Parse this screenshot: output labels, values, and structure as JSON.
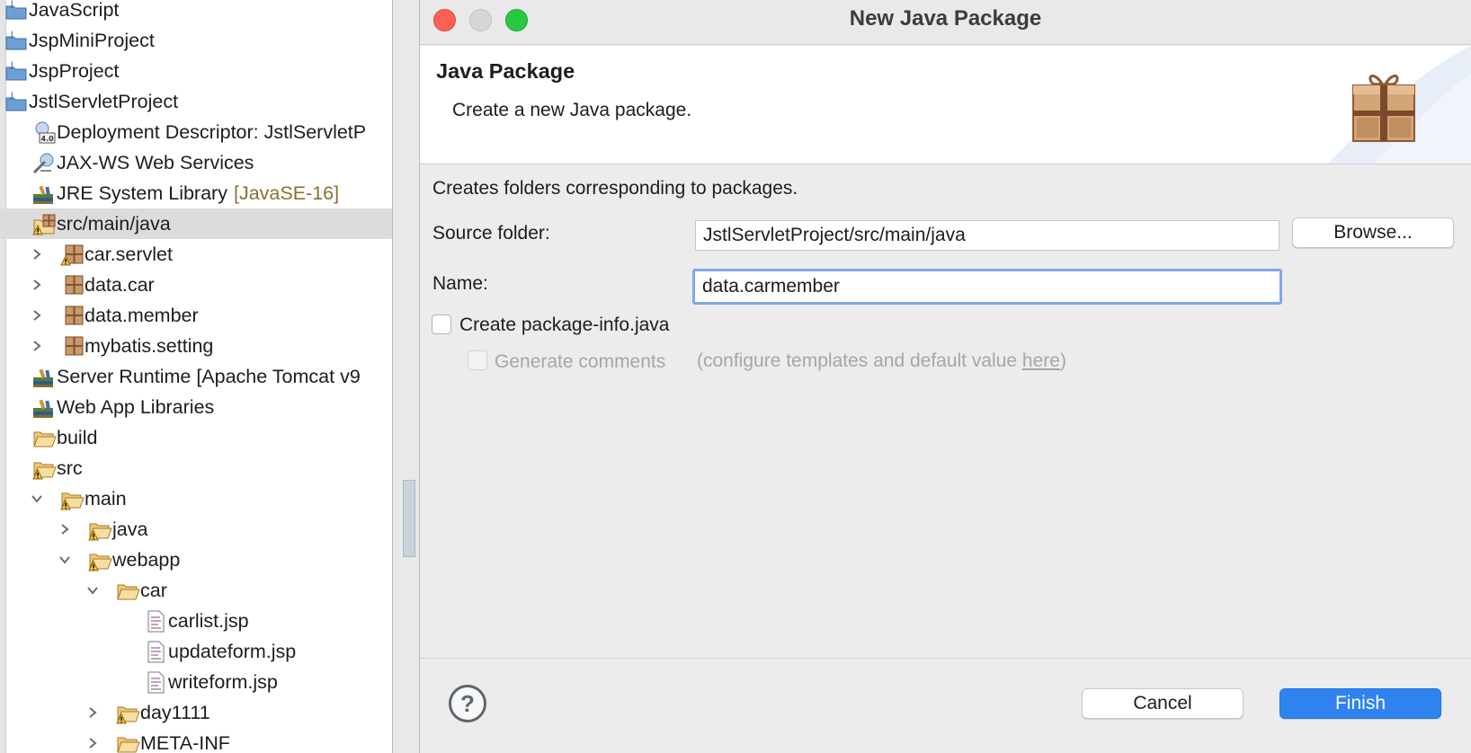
{
  "explorer": {
    "items": [
      {
        "label": "JavaScript",
        "icon": "js-project-icon",
        "indent": 0,
        "twisty": "none"
      },
      {
        "label": "JspMiniProject",
        "icon": "java-project-icon",
        "indent": 0,
        "twisty": "none"
      },
      {
        "label": "JspProject",
        "icon": "java-project-icon",
        "indent": 0,
        "twisty": "none"
      },
      {
        "label": "JstlServletProject",
        "icon": "java-project-icon",
        "indent": 0,
        "twisty": "none"
      },
      {
        "label": "Deployment Descriptor: JstlServletP",
        "icon": "deployment-descriptor-icon",
        "indent": 1,
        "twisty": "none"
      },
      {
        "label": "JAX-WS Web Services",
        "icon": "web-services-icon",
        "indent": 1,
        "twisty": "none"
      },
      {
        "label": "JRE System Library",
        "decoration": "[JavaSE-16]",
        "icon": "library-icon",
        "indent": 1,
        "twisty": "none"
      },
      {
        "label": "src/main/java",
        "icon": "source-folder-icon",
        "indent": 1,
        "twisty": "none",
        "selected": true
      },
      {
        "label": "car.servlet",
        "icon": "package-warning-icon",
        "indent": 2,
        "twisty": "collapsed"
      },
      {
        "label": "data.car",
        "icon": "package-icon",
        "indent": 2,
        "twisty": "collapsed"
      },
      {
        "label": "data.member",
        "icon": "package-icon",
        "indent": 2,
        "twisty": "collapsed"
      },
      {
        "label": "mybatis.setting",
        "icon": "package-icon",
        "indent": 2,
        "twisty": "collapsed"
      },
      {
        "label": "Server Runtime [Apache Tomcat v9",
        "icon": "library-icon",
        "indent": 1,
        "twisty": "none"
      },
      {
        "label": "Web App Libraries",
        "icon": "library-icon",
        "indent": 1,
        "twisty": "none"
      },
      {
        "label": "build",
        "icon": "folder-icon",
        "indent": 1,
        "twisty": "none"
      },
      {
        "label": "src",
        "icon": "folder-warning-icon",
        "indent": 1,
        "twisty": "none"
      },
      {
        "label": "main",
        "icon": "folder-warning-icon",
        "indent": 2,
        "twisty": "expanded"
      },
      {
        "label": "java",
        "icon": "folder-warning-icon",
        "indent": 3,
        "twisty": "collapsed"
      },
      {
        "label": "webapp",
        "icon": "folder-warning-icon",
        "indent": 3,
        "twisty": "expanded"
      },
      {
        "label": "car",
        "icon": "folder-icon",
        "indent": 4,
        "twisty": "expanded"
      },
      {
        "label": "carlist.jsp",
        "icon": "jsp-file-icon",
        "indent": 5,
        "twisty": "none"
      },
      {
        "label": "updateform.jsp",
        "icon": "jsp-file-icon",
        "indent": 5,
        "twisty": "none"
      },
      {
        "label": "writeform.jsp",
        "icon": "jsp-file-icon",
        "indent": 5,
        "twisty": "none"
      },
      {
        "label": "day1111",
        "icon": "folder-warning-icon",
        "indent": 4,
        "twisty": "collapsed"
      },
      {
        "label": "META-INF",
        "icon": "folder-icon",
        "indent": 4,
        "twisty": "collapsed"
      }
    ]
  },
  "dialog": {
    "title": "New Java Package",
    "banner_title": "Java Package",
    "banner_description": "Create a new Java package.",
    "body_description": "Creates folders corresponding to packages.",
    "source_folder_label": "Source folder:",
    "source_folder_value": "JstlServletProject/src/main/java",
    "browse_label": "Browse...",
    "name_label": "Name:",
    "name_value": "data.carmember",
    "create_package_info_label": "Create package-info.java",
    "create_package_info_checked": false,
    "generate_comments_label": "Generate comments",
    "generate_comments_hint_prefix": "(configure templates and default value ",
    "generate_comments_hint_link": "here",
    "generate_comments_hint_suffix": ")",
    "help_symbol": "?",
    "cancel_label": "Cancel",
    "finish_label": "Finish"
  },
  "colors": {
    "accent": "#2f83ef",
    "focus_ring": "#7ea7ea",
    "close": "#fe5f57",
    "zoom": "#28c840",
    "decoration": "#8c6f2e"
  }
}
